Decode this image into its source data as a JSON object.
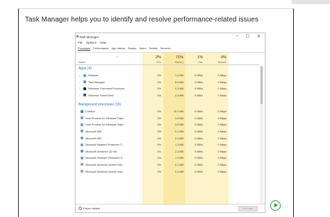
{
  "slide": {
    "title": "Task Manager helps you to identify and resolve performance-related issues"
  },
  "window": {
    "title": "Task Manager",
    "controls": {
      "minimize": "–",
      "maximize": "☐",
      "close": "✕"
    }
  },
  "menu": [
    "File",
    "Options",
    "View"
  ],
  "tabs": [
    "Processes",
    "Performance",
    "App history",
    "Startup",
    "Users",
    "Details",
    "Services"
  ],
  "active_tab": 0,
  "columns": {
    "name_label": "Name",
    "sort_indicator": "^",
    "cpu": {
      "pct": "2%",
      "label": "CPU"
    },
    "memory": {
      "pct": "71%",
      "label": "Memory"
    },
    "disk": {
      "pct": "1%",
      "label": "Disk"
    },
    "network": {
      "pct": "0%",
      "label": "Network"
    }
  },
  "apps_group": "Apps (4)",
  "apps": [
    {
      "name": "Notepad",
      "cpu": "0%",
      "mem": "1.2 MB",
      "disk": "0 MB/s",
      "net": "0 Mbps",
      "icon": "notepad-icon",
      "color": "#5aa0d8"
    },
    {
      "name": "Task Manager",
      "cpu": "0%",
      "mem": "8.0 MB",
      "disk": "0 MB/s",
      "net": "0 Mbps",
      "icon": "task-manager-icon",
      "color": "#6a8fb0"
    },
    {
      "name": "Windows Command Processor",
      "cpu": "0%",
      "mem": "0.1 MB",
      "disk": "0 MB/s",
      "net": "0 Mbps",
      "icon": "cmd-icon",
      "color": "#222222"
    },
    {
      "name": "Windows PowerShell",
      "cpu": "0%",
      "mem": "2.4 MB",
      "disk": "0 MB/s",
      "net": "0 Mbps",
      "icon": "powershell-icon",
      "color": "#2c5aa0"
    }
  ],
  "bg_group": "Background processes (15)",
  "background": [
    {
      "name": "Cortana",
      "cpu": "0%",
      "mem": "32.1 MB",
      "disk": "0 MB/s",
      "net": "0 Mbps",
      "icon": "cortana-icon",
      "color": "#3a7fd0"
    },
    {
      "name": "Host Process for Windows Tasks",
      "cpu": "0%",
      "mem": "3.0 MB",
      "disk": "0 MB/s",
      "net": "0 Mbps",
      "icon": "host-process-icon",
      "color": "#8a9bb0"
    },
    {
      "name": "Host Process for Windows Tasks",
      "cpu": "0%",
      "mem": "3.0 MB",
      "disk": "0 MB/s",
      "net": "0 Mbps",
      "icon": "host-process-icon",
      "color": "#8a9bb0"
    },
    {
      "name": "Microsoft IME",
      "cpu": "0%",
      "mem": "0.1 MB",
      "disk": "0 MB/s",
      "net": "0 Mbps",
      "icon": "ime-icon",
      "color": "#8a9bb0"
    },
    {
      "name": "Microsoft IME",
      "cpu": "0%",
      "mem": "0.1 MB",
      "disk": "0 MB/s",
      "net": "0 Mbps",
      "icon": "ime-icon",
      "color": "#8a9bb0"
    },
    {
      "name": "Microsoft Malware Protection C...",
      "cpu": "0%",
      "mem": "1.1 MB",
      "disk": "0 MB/s",
      "net": "0 Mbps",
      "icon": "malware-protection-icon",
      "color": "#8a9bb0"
    },
    {
      "name": "Microsoft OneDrive (32 bit)",
      "cpu": "0%",
      "mem": "2.1 MB",
      "disk": "0 MB/s",
      "net": "0 Mbps",
      "icon": "onedrive-icon",
      "color": "#7a8a9a"
    },
    {
      "name": "Microsoft Software Protection P...",
      "cpu": "0%",
      "mem": "1.1 MB",
      "disk": "0 MB/s",
      "net": "0 Mbps",
      "icon": "software-protection-icon",
      "color": "#8a9bb0"
    },
    {
      "name": "Microsoft Windows Search Filte...",
      "cpu": "0%",
      "mem": "0.1 MB",
      "disk": "0 MB/s",
      "net": "0 Mbps",
      "icon": "search-filter-icon",
      "color": "#9aa5b0"
    },
    {
      "name": "Microsoft Windows Search Inde...",
      "cpu": "0%",
      "mem": "0.1 MB",
      "disk": "0 MB/s",
      "net": "0 Mbps",
      "icon": "search-indexer-icon",
      "color": "#9aa5b0"
    }
  ],
  "footer": {
    "fewer_details": "Fewer details",
    "end_task": "End task"
  },
  "play_button": "play-icon",
  "colors": {
    "accent": "#2f6fae",
    "heat": "#fdf3c8",
    "heat_strong": "#fae9a6",
    "play": "#1d9a48"
  }
}
